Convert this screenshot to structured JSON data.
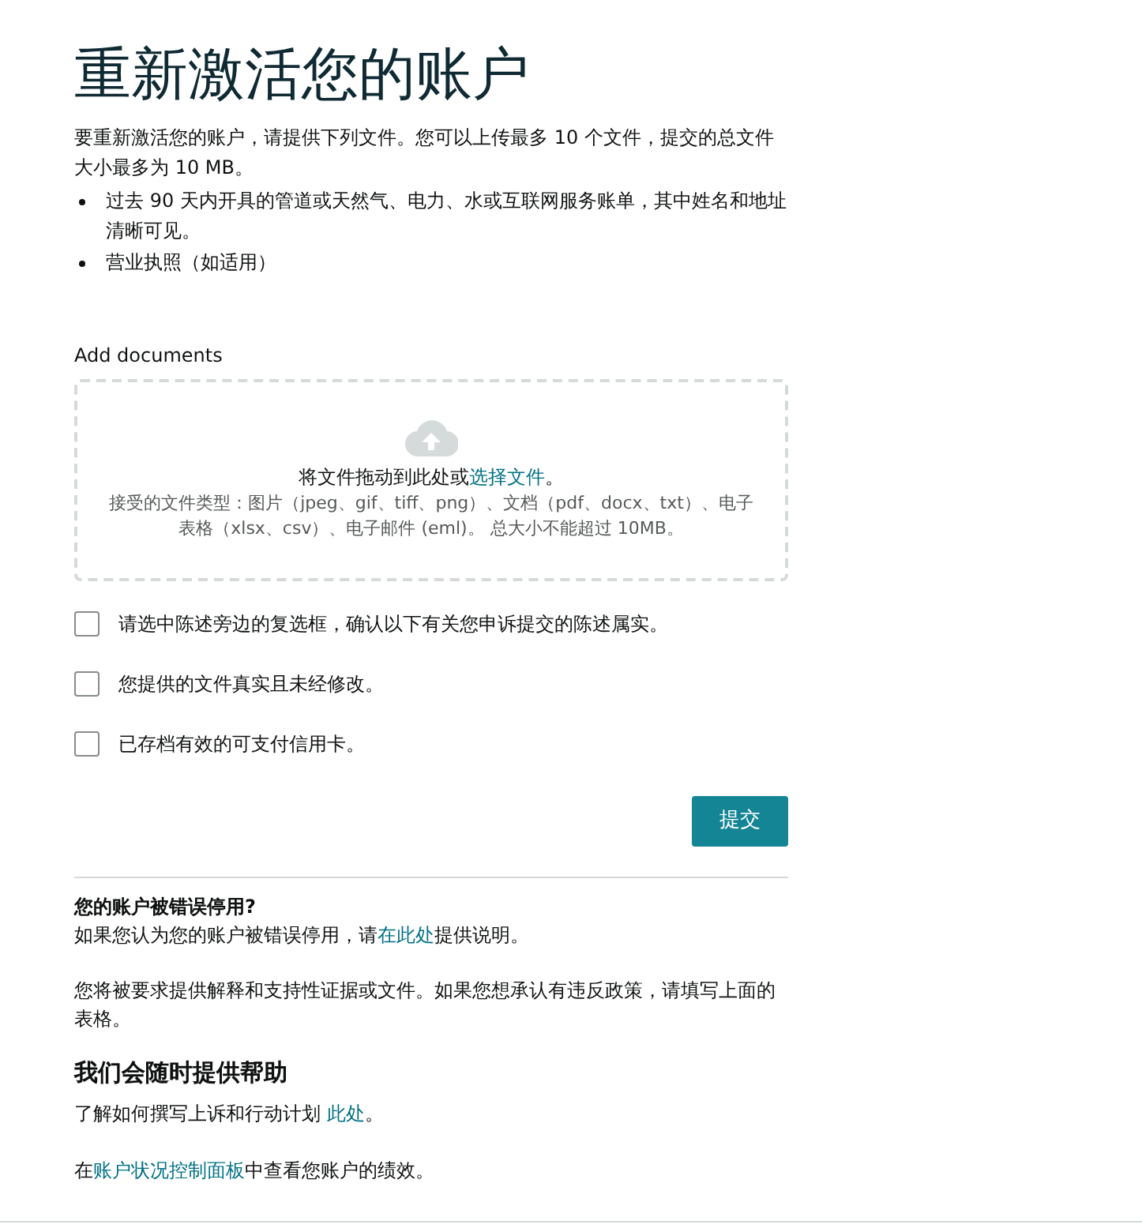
{
  "title": "重新激活您的账户",
  "intro": "要重新激活您的账户，请提供下列文件。您可以上传最多 10 个文件，提交的总文件大小最多为 10 MB。",
  "requirements": [
    "过去 90 天内开具的管道或天然气、电力、水或互联网服务账单，其中姓名和地址清晰可见。",
    "营业执照（如适用）"
  ],
  "upload": {
    "label": "Add documents",
    "prompt_before": "将文件拖动到此处或",
    "prompt_link": "选择文件",
    "prompt_after": "。",
    "accepted": "接受的文件类型：图片（jpeg、gif、tiff、png）、文档（pdf、docx、txt）、电子表格（xlsx、csv）、电子邮件 (eml)。 总大小不能超过 10MB。"
  },
  "confirmations": [
    {
      "label": "请选中陈述旁边的复选框，确认以下有关您申诉提交的陈述属实。",
      "checked": false
    },
    {
      "label": "您提供的文件真实且未经修改。",
      "checked": false
    },
    {
      "label": "已存档有效的可支付信用卡。",
      "checked": false
    }
  ],
  "submit_button": "提交",
  "wrong_deactivation": {
    "heading": "您的账户被错误停用?",
    "text_before": "如果您认为您的账户被错误停用，请",
    "link": "在此处",
    "text_after": "提供说明。"
  },
  "note": "您将被要求提供解释和支持性证据或文件。如果您想承认有违反政策，请填写上面的表格。",
  "help": {
    "heading": "我们会随时提供帮助",
    "line1_before": "了解如何撰写上诉和行动计划 ",
    "line1_link": "此处",
    "line1_after": "。",
    "line2_before": "在",
    "line2_link": "账户状况控制面板",
    "line2_after": "中查看您账户的绩效。"
  }
}
